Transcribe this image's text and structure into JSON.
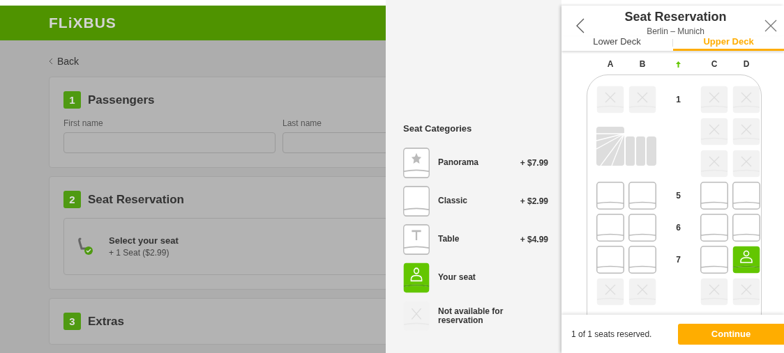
{
  "page": {
    "logo": "FLiXBUS",
    "back": "Back",
    "sections": [
      {
        "number": "1",
        "title": "Passengers",
        "fields": [
          {
            "label": "First name"
          },
          {
            "label": "Last name"
          }
        ]
      },
      {
        "number": "2",
        "title": "Seat Reservation",
        "option": {
          "title": "Select your seat",
          "detail": "+ 1 Seat ($2.99)"
        }
      },
      {
        "number": "3",
        "title": "Extras"
      }
    ]
  },
  "legend": {
    "title": "Seat Categories",
    "items": [
      {
        "kind": "panorama",
        "name": "Panorama",
        "price": "+ $7.99"
      },
      {
        "kind": "classic",
        "name": "Classic",
        "price": "+ $2.99"
      },
      {
        "kind": "table",
        "name": "Table",
        "price": "+ $4.99"
      },
      {
        "kind": "selected",
        "name": "Your seat"
      },
      {
        "kind": "unavailable",
        "name": "Not available for reservation"
      }
    ]
  },
  "panel": {
    "title": "Seat Reservation",
    "subtitle": "Berlin – Munich",
    "tabs": [
      {
        "label": "Lower Deck",
        "selected": false
      },
      {
        "label": "Upper Deck",
        "selected": true
      }
    ],
    "columns": [
      "A",
      "B",
      "C",
      "D"
    ],
    "rows": [
      {
        "label": "1",
        "left": [
          {
            "kind": "unavailable"
          },
          {
            "kind": "unavailable"
          }
        ],
        "right": [
          {
            "kind": "unavailable"
          },
          {
            "kind": "unavailable"
          }
        ]
      },
      {
        "left": [
          {
            "kind": "stairs"
          }
        ],
        "right": [
          {
            "kind": "unavailable"
          },
          {
            "kind": "unavailable"
          }
        ]
      },
      {
        "right": [
          {
            "kind": "unavailable"
          },
          {
            "kind": "unavailable"
          }
        ]
      },
      {
        "label": "5",
        "left": [
          {
            "kind": "available"
          },
          {
            "kind": "available"
          }
        ],
        "right": [
          {
            "kind": "available"
          },
          {
            "kind": "available"
          }
        ]
      },
      {
        "label": "6",
        "left": [
          {
            "kind": "available"
          },
          {
            "kind": "available"
          }
        ],
        "right": [
          {
            "kind": "available"
          },
          {
            "kind": "available"
          }
        ]
      },
      {
        "label": "7",
        "left": [
          {
            "kind": "available"
          },
          {
            "kind": "available"
          }
        ],
        "right": [
          {
            "kind": "available"
          },
          {
            "kind": "selected"
          }
        ]
      },
      {
        "left": [
          {
            "kind": "unavailable"
          },
          {
            "kind": "unavailable"
          }
        ],
        "right": [
          {
            "kind": "unavailable"
          },
          {
            "kind": "unavailable"
          }
        ]
      }
    ],
    "status": "1 of 1 seats reserved.",
    "continue": "Continue"
  }
}
